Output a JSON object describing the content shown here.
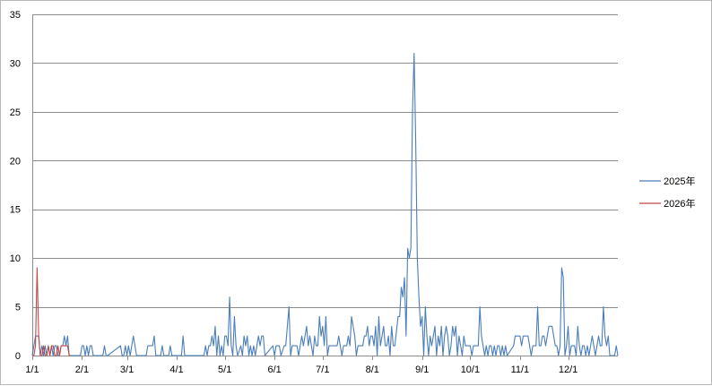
{
  "chart_data": {
    "type": "line",
    "title": "",
    "xlabel": "",
    "ylabel": "",
    "ylim": [
      0,
      35
    ],
    "y_ticks": [
      "0",
      "5",
      "10",
      "15",
      "20",
      "25",
      "30",
      "35"
    ],
    "x_tick_labels": [
      "1/1",
      "2/1",
      "3/1",
      "4/1",
      "5/1",
      "6/1",
      "7/1",
      "8/1",
      "9/1",
      "10/1",
      "11/1",
      "12/1"
    ],
    "x_tick_days": [
      0,
      31,
      59,
      90,
      120,
      151,
      181,
      212,
      243,
      273,
      304,
      334
    ],
    "x_range_days": [
      0,
      365
    ],
    "grid": "horizontal",
    "legend_position": "right",
    "series": [
      {
        "name": "2025年",
        "color": "#4a7ebb",
        "points": [
          [
            0,
            0
          ],
          [
            1,
            1
          ],
          [
            2,
            2
          ],
          [
            3,
            2
          ],
          [
            4,
            2
          ],
          [
            5,
            0
          ],
          [
            6,
            1
          ],
          [
            7,
            0
          ],
          [
            8,
            1
          ],
          [
            9,
            0
          ],
          [
            10,
            1
          ],
          [
            11,
            0
          ],
          [
            12,
            1
          ],
          [
            13,
            0
          ],
          [
            14,
            1
          ],
          [
            15,
            1
          ],
          [
            16,
            0
          ],
          [
            17,
            0
          ],
          [
            18,
            1
          ],
          [
            19,
            1
          ],
          [
            20,
            2
          ],
          [
            21,
            1
          ],
          [
            22,
            2
          ],
          [
            23,
            0
          ],
          [
            24,
            0
          ],
          [
            30,
            0
          ],
          [
            31,
            1
          ],
          [
            32,
            1
          ],
          [
            33,
            0
          ],
          [
            34,
            1
          ],
          [
            35,
            0
          ],
          [
            36,
            1
          ],
          [
            37,
            1
          ],
          [
            38,
            0
          ],
          [
            44,
            0
          ],
          [
            45,
            1
          ],
          [
            46,
            0
          ],
          [
            47,
            0
          ],
          [
            55,
            1
          ],
          [
            56,
            0
          ],
          [
            57,
            0
          ],
          [
            58,
            1
          ],
          [
            59,
            0
          ],
          [
            60,
            1
          ],
          [
            61,
            0
          ],
          [
            62,
            1
          ],
          [
            63,
            2
          ],
          [
            64,
            1
          ],
          [
            65,
            0
          ],
          [
            71,
            0
          ],
          [
            72,
            1
          ],
          [
            73,
            1
          ],
          [
            74,
            1
          ],
          [
            75,
            1
          ],
          [
            76,
            2
          ],
          [
            77,
            0
          ],
          [
            80,
            0
          ],
          [
            81,
            1
          ],
          [
            82,
            0
          ],
          [
            85,
            0
          ],
          [
            86,
            1
          ],
          [
            87,
            0
          ],
          [
            93,
            0
          ],
          [
            94,
            2
          ],
          [
            95,
            0
          ],
          [
            107,
            0
          ],
          [
            108,
            1
          ],
          [
            109,
            0
          ],
          [
            110,
            1
          ],
          [
            111,
            1
          ],
          [
            112,
            2
          ],
          [
            113,
            1
          ],
          [
            114,
            3
          ],
          [
            115,
            0
          ],
          [
            116,
            2
          ],
          [
            117,
            0
          ],
          [
            118,
            1
          ],
          [
            119,
            0
          ],
          [
            120,
            2
          ],
          [
            121,
            2
          ],
          [
            122,
            1
          ],
          [
            123,
            6
          ],
          [
            124,
            1
          ],
          [
            125,
            0
          ],
          [
            126,
            4
          ],
          [
            127,
            1
          ],
          [
            128,
            0
          ],
          [
            130,
            1
          ],
          [
            131,
            0
          ],
          [
            132,
            2
          ],
          [
            133,
            1
          ],
          [
            134,
            2
          ],
          [
            135,
            0
          ],
          [
            136,
            1
          ],
          [
            137,
            0
          ],
          [
            138,
            1
          ],
          [
            139,
            0
          ],
          [
            140,
            1
          ],
          [
            141,
            2
          ],
          [
            142,
            1
          ],
          [
            143,
            2
          ],
          [
            144,
            2
          ],
          [
            145,
            0
          ],
          [
            150,
            1
          ],
          [
            151,
            0
          ],
          [
            152,
            1
          ],
          [
            153,
            1
          ],
          [
            154,
            1
          ],
          [
            155,
            0
          ],
          [
            157,
            1
          ],
          [
            158,
            1
          ],
          [
            159,
            3
          ],
          [
            160,
            5
          ],
          [
            161,
            0
          ],
          [
            162,
            1
          ],
          [
            163,
            1
          ],
          [
            164,
            1
          ],
          [
            165,
            1
          ],
          [
            166,
            0
          ],
          [
            167,
            1
          ],
          [
            168,
            2
          ],
          [
            169,
            1
          ],
          [
            170,
            2
          ],
          [
            171,
            3
          ],
          [
            172,
            1
          ],
          [
            173,
            2
          ],
          [
            174,
            1
          ],
          [
            175,
            0
          ],
          [
            176,
            2
          ],
          [
            177,
            1
          ],
          [
            178,
            1
          ],
          [
            179,
            4
          ],
          [
            180,
            2
          ],
          [
            181,
            3
          ],
          [
            182,
            1
          ],
          [
            183,
            4
          ],
          [
            184,
            0
          ],
          [
            185,
            1
          ],
          [
            186,
            1
          ],
          [
            190,
            1
          ],
          [
            191,
            2
          ],
          [
            192,
            1
          ],
          [
            193,
            0
          ],
          [
            194,
            1
          ],
          [
            195,
            1
          ],
          [
            196,
            1
          ],
          [
            197,
            2
          ],
          [
            198,
            1
          ],
          [
            199,
            4
          ],
          [
            200,
            3
          ],
          [
            201,
            2
          ],
          [
            202,
            0
          ],
          [
            203,
            1
          ],
          [
            204,
            1
          ],
          [
            205,
            1
          ],
          [
            206,
            1
          ],
          [
            207,
            2
          ],
          [
            208,
            2
          ],
          [
            209,
            3
          ],
          [
            210,
            1
          ],
          [
            211,
            2
          ],
          [
            212,
            2
          ],
          [
            213,
            1
          ],
          [
            214,
            3
          ],
          [
            215,
            0
          ],
          [
            216,
            4
          ],
          [
            217,
            1
          ],
          [
            218,
            2
          ],
          [
            219,
            3
          ],
          [
            220,
            1
          ],
          [
            221,
            1
          ],
          [
            222,
            2
          ],
          [
            223,
            0
          ],
          [
            224,
            3
          ],
          [
            225,
            1
          ],
          [
            226,
            1
          ],
          [
            228,
            4
          ],
          [
            229,
            4
          ],
          [
            230,
            7
          ],
          [
            231,
            6
          ],
          [
            232,
            8
          ],
          [
            233,
            2
          ],
          [
            234,
            11
          ],
          [
            235,
            10
          ],
          [
            236,
            11
          ],
          [
            237,
            25
          ],
          [
            238,
            31
          ],
          [
            239,
            22
          ],
          [
            240,
            10
          ],
          [
            241,
            6
          ],
          [
            242,
            3
          ],
          [
            243,
            4
          ],
          [
            244,
            0
          ],
          [
            245,
            5
          ],
          [
            246,
            2
          ],
          [
            247,
            0
          ],
          [
            248,
            2
          ],
          [
            249,
            1
          ],
          [
            250,
            2
          ],
          [
            251,
            3
          ],
          [
            252,
            0
          ],
          [
            253,
            2
          ],
          [
            254,
            1
          ],
          [
            255,
            3
          ],
          [
            256,
            0
          ],
          [
            257,
            2
          ],
          [
            258,
            3
          ],
          [
            259,
            2
          ],
          [
            260,
            0
          ],
          [
            261,
            1
          ],
          [
            262,
            3
          ],
          [
            263,
            2
          ],
          [
            264,
            3
          ],
          [
            265,
            0
          ],
          [
            266,
            2
          ],
          [
            267,
            1
          ],
          [
            268,
            0
          ],
          [
            269,
            2
          ],
          [
            270,
            1
          ],
          [
            271,
            1
          ],
          [
            272,
            1
          ],
          [
            273,
            1
          ],
          [
            274,
            0
          ],
          [
            275,
            1
          ],
          [
            276,
            1
          ],
          [
            277,
            1
          ],
          [
            278,
            1
          ],
          [
            279,
            5
          ],
          [
            280,
            2
          ],
          [
            281,
            1
          ],
          [
            282,
            0
          ],
          [
            283,
            1
          ],
          [
            284,
            0
          ],
          [
            285,
            1
          ],
          [
            286,
            1
          ],
          [
            287,
            0
          ],
          [
            288,
            1
          ],
          [
            289,
            0
          ],
          [
            290,
            1
          ],
          [
            291,
            1
          ],
          [
            292,
            0
          ],
          [
            293,
            1
          ],
          [
            294,
            0
          ],
          [
            295,
            1
          ],
          [
            296,
            0
          ],
          [
            300,
            1
          ],
          [
            301,
            2
          ],
          [
            302,
            2
          ],
          [
            303,
            2
          ],
          [
            304,
            2
          ],
          [
            305,
            1
          ],
          [
            306,
            2
          ],
          [
            307,
            2
          ],
          [
            308,
            2
          ],
          [
            309,
            2
          ],
          [
            310,
            1
          ],
          [
            311,
            0
          ],
          [
            312,
            1
          ],
          [
            313,
            1
          ],
          [
            314,
            1
          ],
          [
            315,
            5
          ],
          [
            316,
            1
          ],
          [
            317,
            1
          ],
          [
            318,
            2
          ],
          [
            319,
            2
          ],
          [
            320,
            1
          ],
          [
            321,
            2
          ],
          [
            322,
            3
          ],
          [
            323,
            3
          ],
          [
            324,
            3
          ],
          [
            325,
            2
          ],
          [
            326,
            1
          ],
          [
            327,
            1
          ],
          [
            328,
            0
          ],
          [
            329,
            1
          ],
          [
            330,
            9
          ],
          [
            331,
            8
          ],
          [
            332,
            0
          ],
          [
            333,
            1
          ],
          [
            334,
            3
          ],
          [
            335,
            0
          ],
          [
            336,
            1
          ],
          [
            337,
            1
          ],
          [
            338,
            1
          ],
          [
            339,
            0
          ],
          [
            340,
            3
          ],
          [
            341,
            1
          ],
          [
            342,
            0
          ],
          [
            343,
            1
          ],
          [
            344,
            1
          ],
          [
            345,
            0
          ],
          [
            346,
            1
          ],
          [
            347,
            0
          ],
          [
            348,
            1
          ],
          [
            349,
            2
          ],
          [
            350,
            1
          ],
          [
            351,
            0
          ],
          [
            352,
            1
          ],
          [
            353,
            2
          ],
          [
            354,
            1
          ],
          [
            355,
            1
          ],
          [
            356,
            5
          ],
          [
            357,
            2
          ],
          [
            358,
            1
          ],
          [
            359,
            2
          ],
          [
            360,
            0
          ],
          [
            363,
            0
          ],
          [
            364,
            1
          ],
          [
            365,
            0
          ]
        ]
      },
      {
        "name": "2026年",
        "color": "#be4b48",
        "points": [
          [
            0,
            0
          ],
          [
            1,
            0
          ],
          [
            2,
            1
          ],
          [
            3,
            9
          ],
          [
            4,
            2
          ],
          [
            5,
            0
          ],
          [
            6,
            0
          ],
          [
            7,
            1
          ],
          [
            8,
            0
          ],
          [
            9,
            0
          ],
          [
            10,
            1
          ],
          [
            11,
            0
          ],
          [
            12,
            1
          ],
          [
            13,
            1
          ],
          [
            14,
            0
          ],
          [
            15,
            0
          ],
          [
            16,
            1
          ],
          [
            17,
            0
          ],
          [
            18,
            1
          ],
          [
            19,
            1
          ],
          [
            20,
            1
          ],
          [
            21,
            1
          ],
          [
            22,
            1
          ],
          [
            23,
            0
          ],
          [
            24,
            0
          ]
        ]
      }
    ]
  }
}
